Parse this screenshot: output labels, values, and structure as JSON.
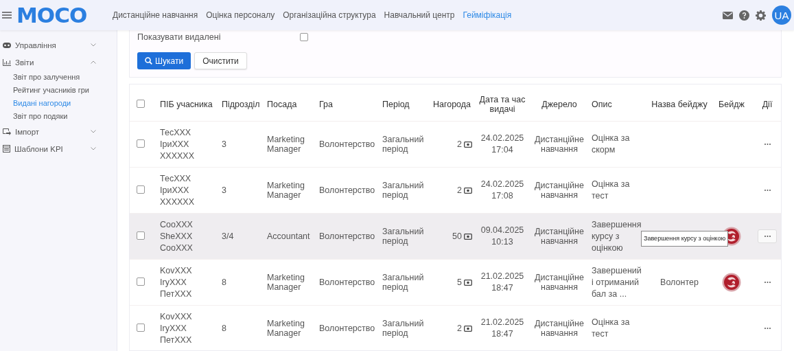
{
  "header": {
    "logo": "MOCO",
    "nav": [
      {
        "label": "Дистанційне навчання",
        "selected": false
      },
      {
        "label": "Оцінка персоналу",
        "selected": false
      },
      {
        "label": "Організаційна структура",
        "selected": false
      },
      {
        "label": "Навчальний центр",
        "selected": false
      },
      {
        "label": "Гейміфікація",
        "selected": true
      }
    ],
    "avatar": "UA"
  },
  "sidebar": {
    "items": [
      {
        "label": "Управління",
        "expanded": false
      },
      {
        "label": "Звіти",
        "expanded": true,
        "children": [
          {
            "label": "Звіт про залучення",
            "selected": false
          },
          {
            "label": "Рейтинг учасників гри",
            "selected": false
          },
          {
            "label": "Видані нагороди",
            "selected": true
          },
          {
            "label": "Звіт про подяки",
            "selected": false
          }
        ]
      },
      {
        "label": "Імпорт",
        "expanded": false
      },
      {
        "label": "Шаблони KPI",
        "expanded": false
      }
    ]
  },
  "filters": {
    "show_deleted": {
      "label": "Показувати видалені",
      "checked": false
    },
    "buttons": [
      {
        "label": "Шукати",
        "kind": "primary"
      },
      {
        "label": "Очистити",
        "kind": "secondary"
      }
    ]
  },
  "table": {
    "all_checked": false,
    "columns": [
      "ПІБ учасника",
      "Підрозділ",
      "Посада",
      "Гра",
      "Період",
      "Нагорода",
      "Дата та час видачі",
      "Джерело",
      "Опис",
      "Назва бейджу",
      "Бейдж",
      "Дії"
    ],
    "rows": [
      {
        "checked": false,
        "hovered": false,
        "name": [
          "ТесХХХ",
          "ІриХХХ",
          "ХХХХХХ"
        ],
        "department": "3",
        "position": "Marketing Manager",
        "game": "Волонтерство",
        "period": "Загальний період",
        "reward": "2",
        "date": "24.02.2025",
        "time": "17:04",
        "source": "Дистанційне навчання",
        "description": "Оцінка за скорм",
        "badge": false
      },
      {
        "checked": false,
        "hovered": false,
        "name": [
          "ТесХХХ",
          "ІриХХХ",
          "ХХХХХХ"
        ],
        "department": "3",
        "position": "Marketing Manager",
        "game": "Волонтерство",
        "period": "Загальний період",
        "reward": "2",
        "date": "24.02.2025",
        "time": "17:08",
        "source": "Дистанційне навчання",
        "description": "Оцінка за тест",
        "badge": false
      },
      {
        "checked": false,
        "hovered": true,
        "name": [
          "СооХХХ",
          "SheXXX",
          "СооХХХ"
        ],
        "department": "3/4",
        "position": "Accountant",
        "game": "Волонтерство",
        "period": "Загальний період",
        "reward": "50",
        "date": "09.04.2025",
        "time": "10:13",
        "source": "Дистанційне навчання",
        "description": "Завершення курсу з оцінкою",
        "badge": true,
        "tooltip": "Завершення курсу з оцінкою"
      },
      {
        "checked": false,
        "hovered": false,
        "name": [
          "KovXXX",
          "IryXXX",
          "ПетХХХ"
        ],
        "department": "8",
        "position": "Marketing Manager",
        "game": "Волонтерство",
        "period": "Загальний період",
        "reward": "5",
        "date": "21.02.2025",
        "time": "18:47",
        "source": "Дистанційне навчання",
        "description": "Завершений і отриманий бал за ...",
        "badge_name": "Волонтер",
        "badge": true
      },
      {
        "checked": false,
        "hovered": false,
        "name": [
          "KovXXX",
          "IryXXX",
          "ПетХХХ"
        ],
        "department": "8",
        "position": "Marketing Manager",
        "game": "Волонтерство",
        "period": "Загальний період",
        "reward": "2",
        "date": "21.02.2025",
        "time": "18:47",
        "source": "Дистанційне навчання",
        "description": "Оцінка за тест",
        "badge": false
      }
    ]
  }
}
